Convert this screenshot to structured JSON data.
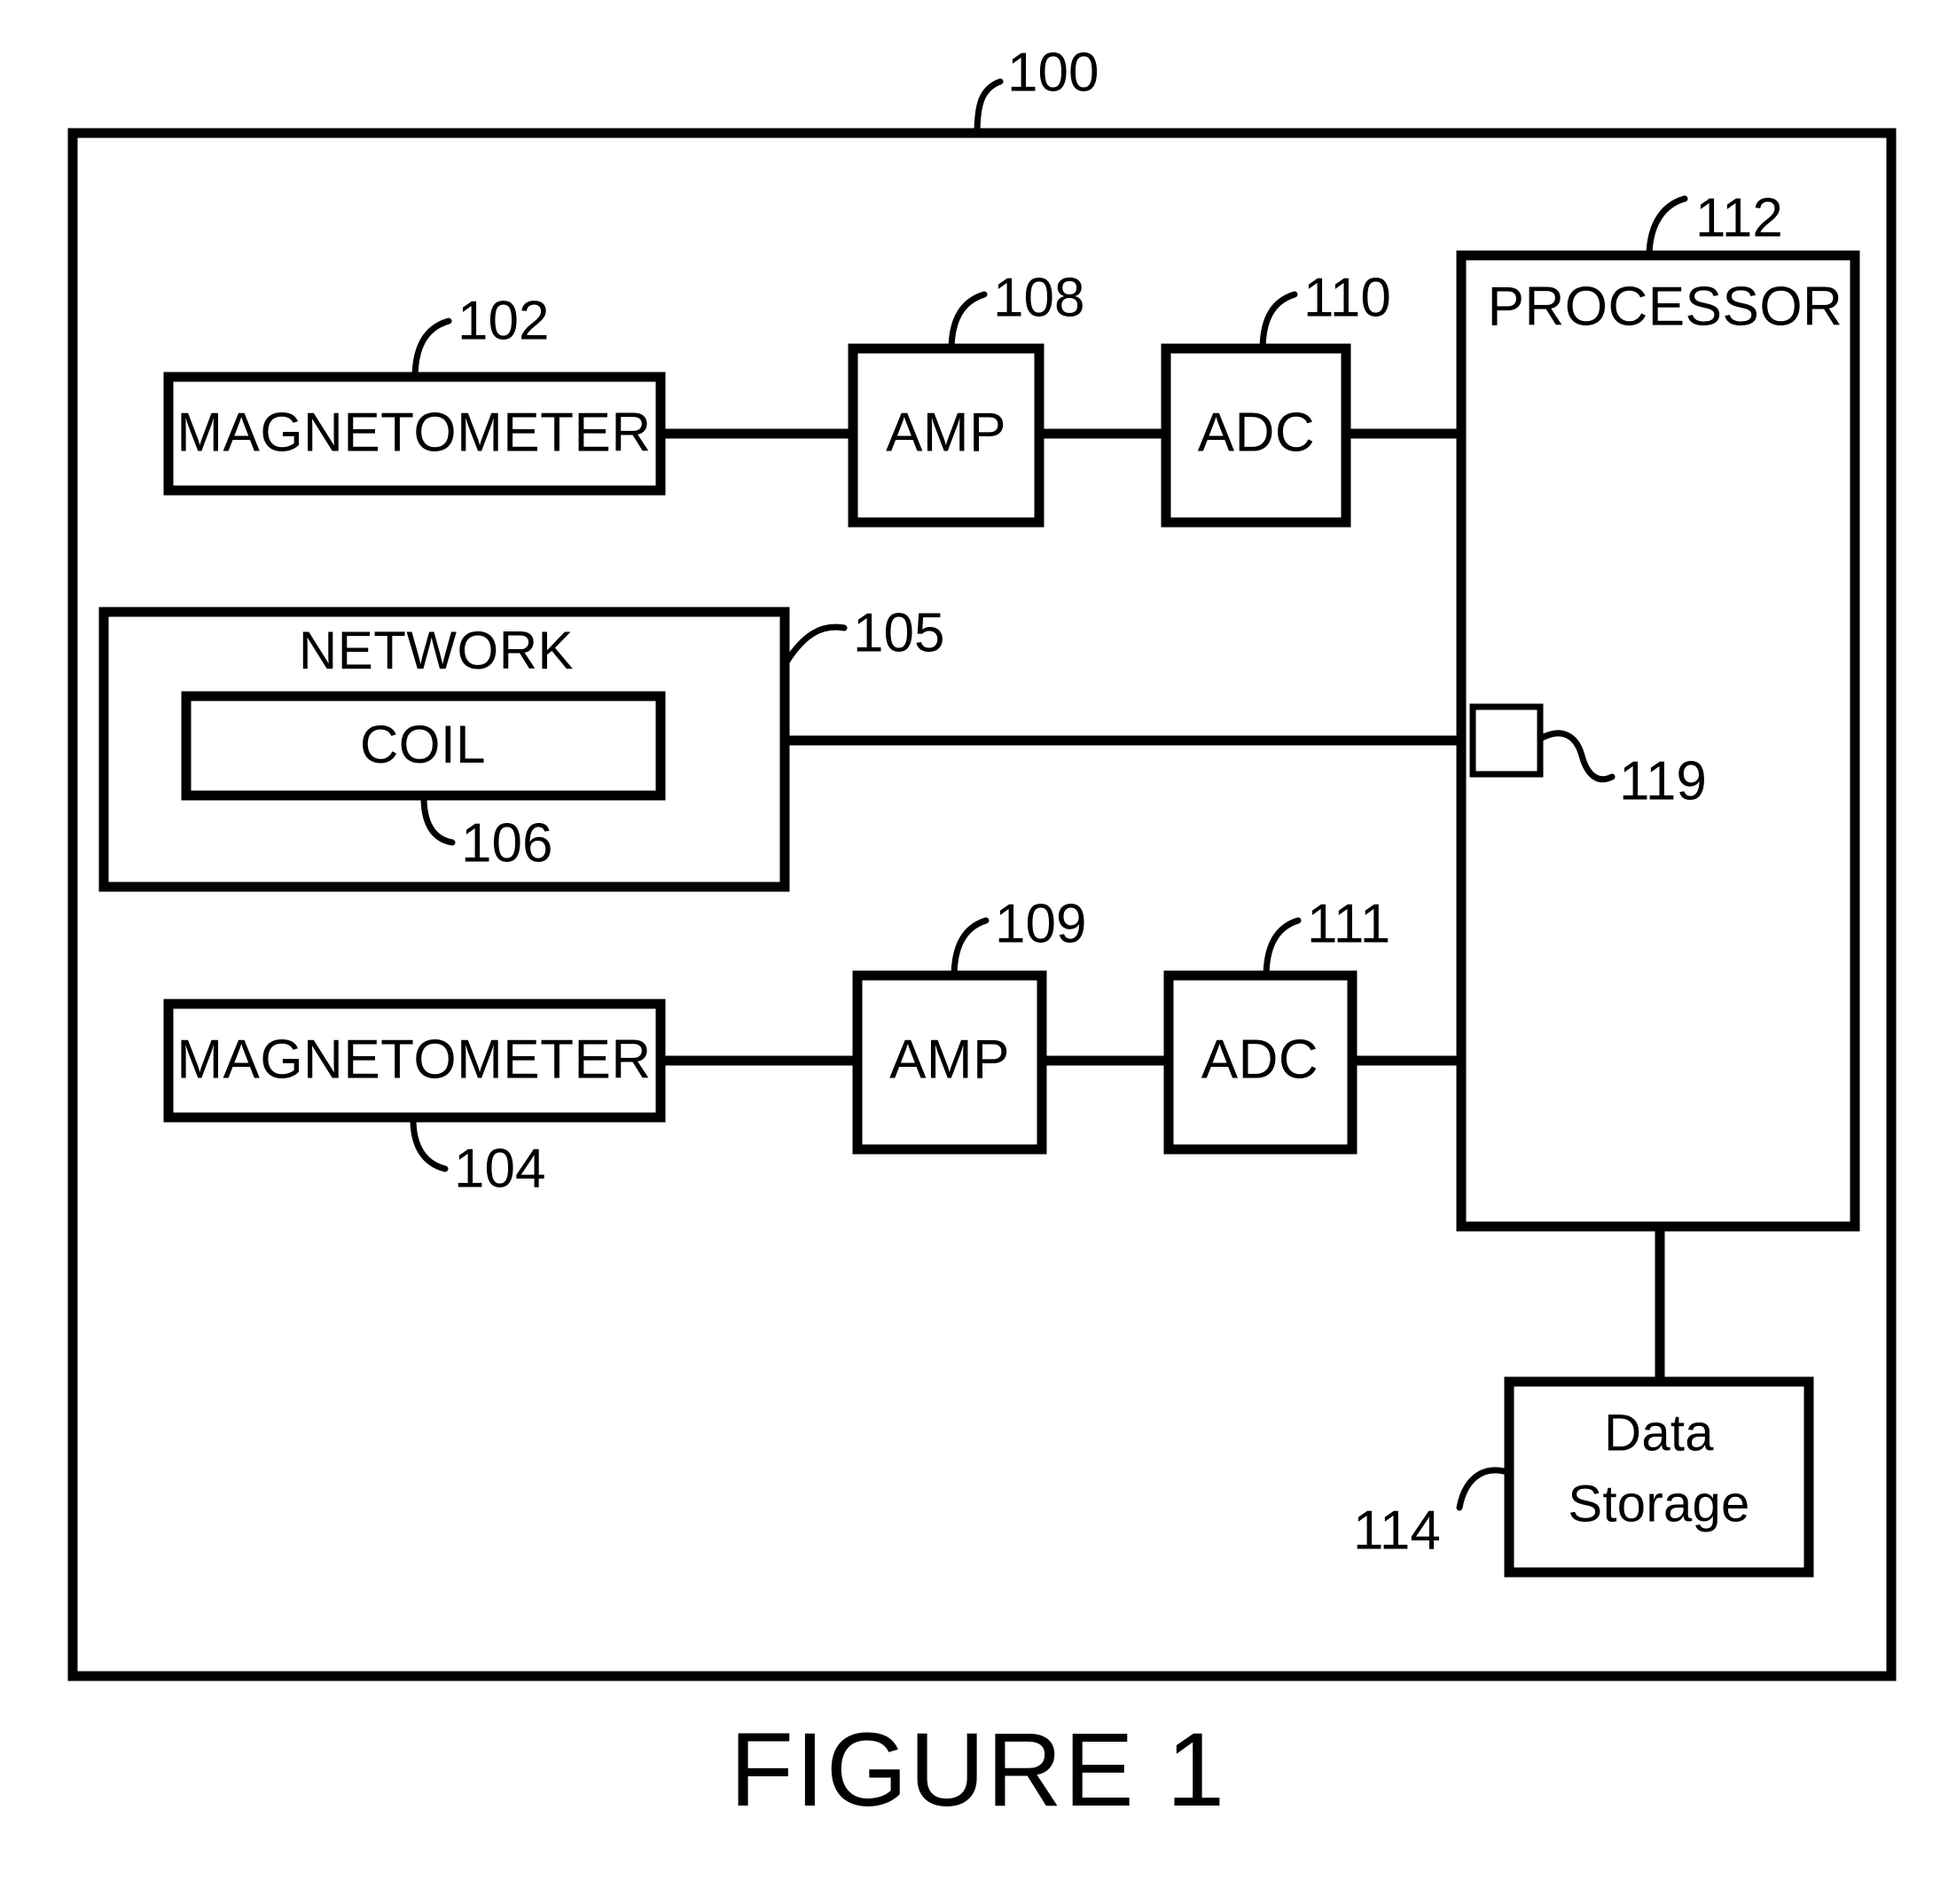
{
  "figure": {
    "caption": "FIGURE 1",
    "system_ref": "100"
  },
  "blocks": {
    "magnetometer_top": {
      "label": "MAGNETOMETER",
      "ref": "102"
    },
    "magnetometer_bottom": {
      "label": "MAGNETOMETER",
      "ref": "104"
    },
    "network": {
      "label": "NETWORK",
      "ref": "105"
    },
    "coil": {
      "label": "COIL",
      "ref": "106"
    },
    "amp_top": {
      "label": "AMP",
      "ref": "108"
    },
    "amp_bottom": {
      "label": "AMP",
      "ref": "109"
    },
    "adc_top": {
      "label": "ADC",
      "ref": "110"
    },
    "adc_bottom": {
      "label": "ADC",
      "ref": "111"
    },
    "processor": {
      "label": "PROCESSOR",
      "ref": "112"
    },
    "data_storage": {
      "label_line1": "Data",
      "label_line2": "Storage",
      "ref": "114"
    },
    "port": {
      "ref": "119"
    }
  },
  "colors": {
    "ink": "#000000",
    "paper": "#ffffff"
  }
}
